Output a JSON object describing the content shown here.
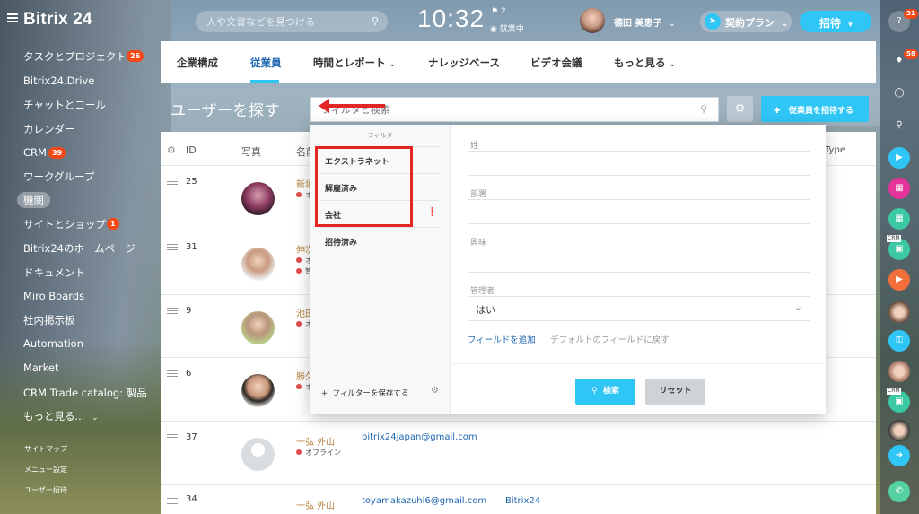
{
  "app": {
    "logo": "Bitrix 24"
  },
  "header": {
    "search_placeholder": "人や文書などを見つける",
    "clock": "10:32",
    "flag_count": "2",
    "work_status": "就業中",
    "user_name": "德田 美恵子",
    "plan_label": "契約プラン",
    "invite_label": "招待"
  },
  "right_rail": {
    "help_badge": "31",
    "notifications_badge": "58",
    "crm_label": "CRM"
  },
  "sidebar": {
    "items": [
      {
        "label": "タスクとプロジェクト",
        "badge": "26"
      },
      {
        "label": "Bitrix24.Drive"
      },
      {
        "label": "チャットとコール"
      },
      {
        "label": "カレンダー"
      },
      {
        "label": "CRM",
        "badge": "39"
      },
      {
        "label": "ワークグループ"
      },
      {
        "label": "機関"
      },
      {
        "label": "サイトとショップ",
        "badge": "1"
      },
      {
        "label": "Bitrix24のホームページ"
      },
      {
        "label": "ドキュメント"
      },
      {
        "label": "Miro Boards"
      },
      {
        "label": "社内掲示板"
      },
      {
        "label": "Automation"
      },
      {
        "label": "Market"
      },
      {
        "label": "CRM Trade catalog: 製品"
      },
      {
        "label": "もっと見る..."
      }
    ],
    "footer": [
      "サイトマップ",
      "メニュー設定",
      "ユーザー招待"
    ]
  },
  "tabs": [
    {
      "label": "企業構成"
    },
    {
      "label": "従業員"
    },
    {
      "label": "時間とレポート"
    },
    {
      "label": "ナレッジベース"
    },
    {
      "label": "ビデオ会議"
    },
    {
      "label": "もっと見る"
    }
  ],
  "page": {
    "title": "ユーザーを探す",
    "filter_placeholder": "フィルタと検索",
    "add_employee_label": "従業員を招待する"
  },
  "grid": {
    "headers": {
      "id": "ID",
      "photo": "写真",
      "name": "名前",
      "type": "Type"
    },
    "rows": [
      {
        "id": "25",
        "name": "新垣",
        "status": "オフライン",
        "email": "",
        "company": ""
      },
      {
        "id": "31",
        "name": "伸次",
        "status": "オフライン",
        "extra": "管理",
        "email": "",
        "company": ""
      },
      {
        "id": "9",
        "name": "池田",
        "status": "オフライン",
        "email": "",
        "company": ""
      },
      {
        "id": "6",
        "name": "勝久",
        "status": "オフライン",
        "email": "",
        "company": ""
      },
      {
        "id": "37",
        "name": "一弘 外山",
        "status": "オフライン",
        "email": "bitrix24japan@gmail.com",
        "company": ""
      },
      {
        "id": "34",
        "name": "一弘 外山",
        "status": "オフライン",
        "email": "toyamakazuhi6@gmail.com",
        "company": "Bitrix24"
      }
    ]
  },
  "filter_popup": {
    "header": "フィルタ",
    "presets": [
      "エクストラネット",
      "解雇済み",
      "会社",
      "招待済み"
    ],
    "save_filter": "フィルターを保存する",
    "fields": {
      "last_name": "姓",
      "department": "部署",
      "interests": "興味",
      "manager": "管理者"
    },
    "manager_value": "はい",
    "add_field": "フィールドを追加",
    "reset_fields": "デフォルトのフィールドに戻す",
    "search_btn": "検索",
    "reset_btn": "リセット"
  },
  "colors": {
    "accent": "#2fc6f6",
    "link": "#2067b0",
    "badge": "#f44818",
    "annotation": "#e32525"
  }
}
